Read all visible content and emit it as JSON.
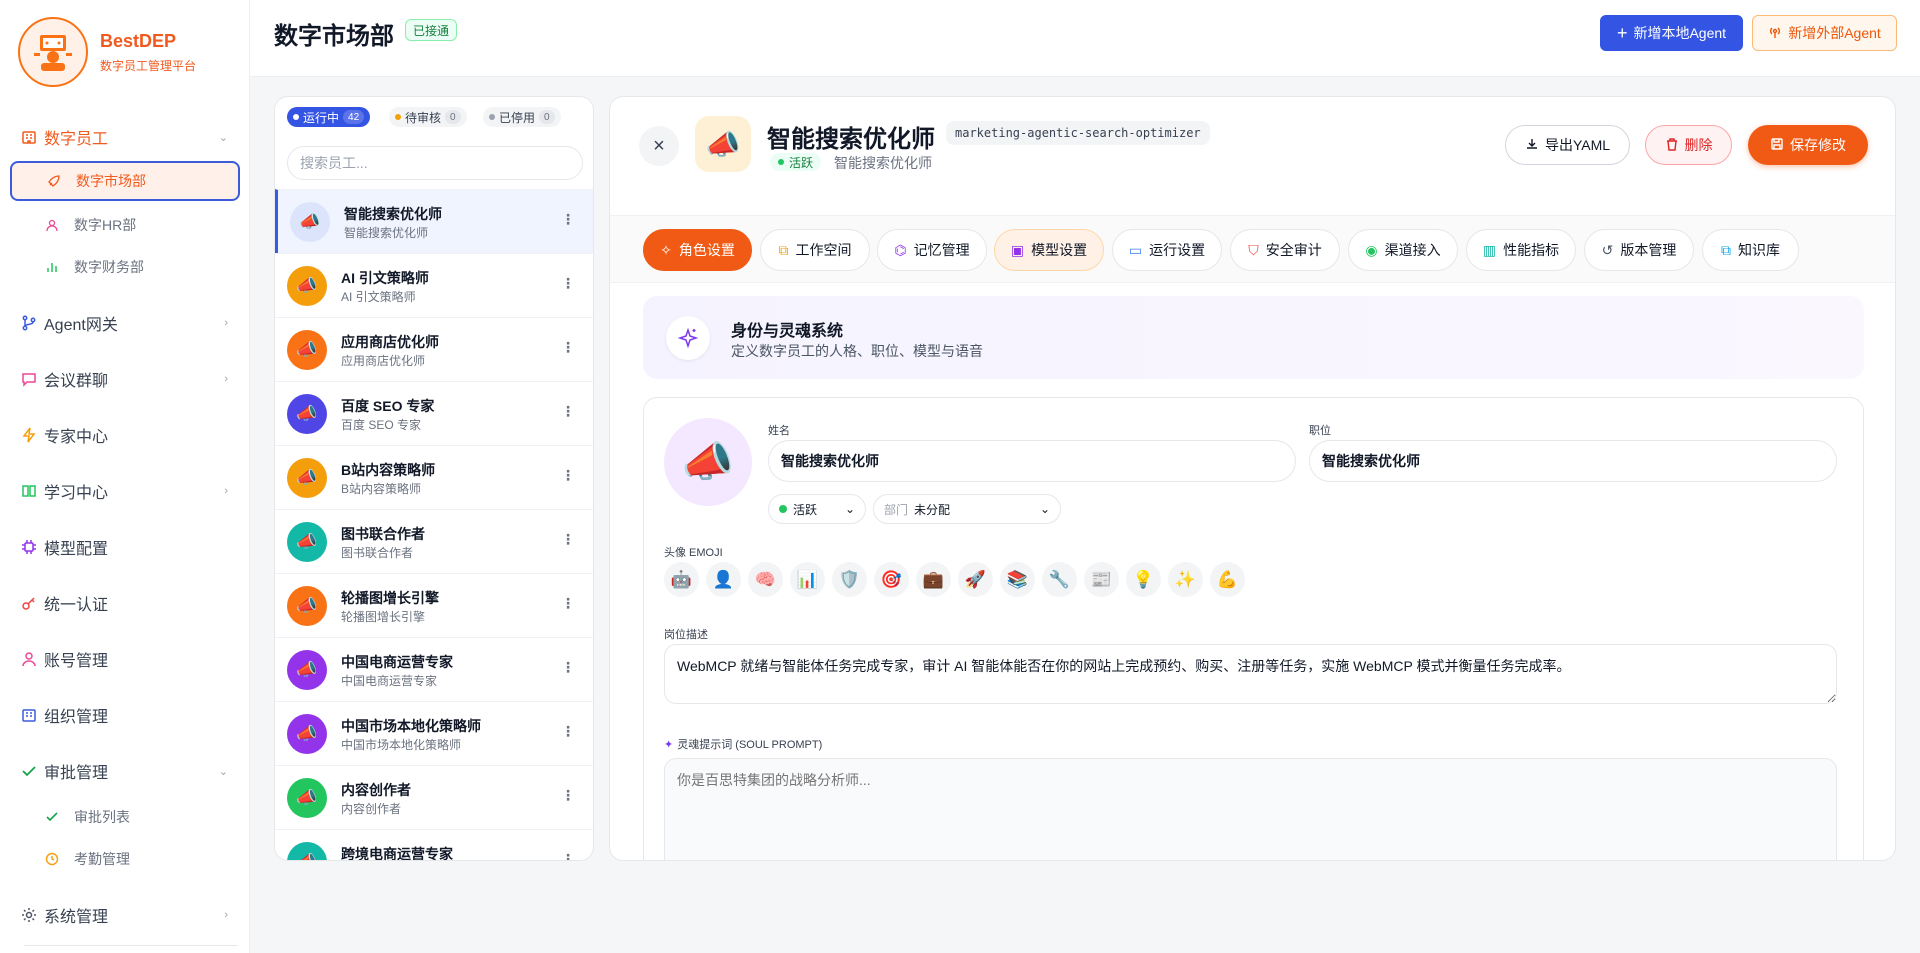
{
  "brand": {
    "name": "BestDEP",
    "subtitle": "数字员工管理平台"
  },
  "sidebar": {
    "items": [
      {
        "label": "数字员工",
        "icon": "building-icon"
      },
      {
        "label": "Agent网关",
        "icon": "branch-icon"
      },
      {
        "label": "会议群聊",
        "icon": "chat-icon"
      },
      {
        "label": "专家中心",
        "icon": "bolt-icon"
      },
      {
        "label": "学习中心",
        "icon": "book-icon"
      },
      {
        "label": "模型配置",
        "icon": "chip-icon"
      },
      {
        "label": "统一认证",
        "icon": "key-icon"
      },
      {
        "label": "账号管理",
        "icon": "user-icon"
      },
      {
        "label": "组织管理",
        "icon": "building-icon"
      },
      {
        "label": "审批管理",
        "icon": "check-icon"
      },
      {
        "label": "系统管理",
        "icon": "gear-icon"
      }
    ],
    "sub_digital": [
      "数字市场部",
      "数字HR部",
      "数字财务部"
    ],
    "sub_approval": [
      "审批列表",
      "考勤管理"
    ]
  },
  "header": {
    "title": "数字市场部",
    "badge": "已接通",
    "btn_local": "新增本地Agent",
    "btn_external": "新增外部Agent"
  },
  "list": {
    "filters": [
      {
        "label": "运行中",
        "count": "42",
        "color": "#3b5bdb"
      },
      {
        "label": "待审核",
        "count": "0",
        "color": "#f59e0b"
      },
      {
        "label": "已停用",
        "count": "0",
        "color": "#9ca3af"
      }
    ],
    "search_placeholder": "搜索员工...",
    "employees": [
      {
        "name": "智能搜索优化师",
        "role": "智能搜索优化师",
        "color": "#dbe4fb"
      },
      {
        "name": "AI 引文策略师",
        "role": "AI 引文策略师",
        "color": "#f59e0b"
      },
      {
        "name": "应用商店优化师",
        "role": "应用商店优化师",
        "color": "#f97316"
      },
      {
        "name": "百度 SEO 专家",
        "role": "百度 SEO 专家",
        "color": "#4f46e5"
      },
      {
        "name": "B站内容策略师",
        "role": "B站内容策略师",
        "color": "#f59e0b"
      },
      {
        "name": "图书联合作者",
        "role": "图书联合作者",
        "color": "#14b8a6"
      },
      {
        "name": "轮播图增长引擎",
        "role": "轮播图增长引擎",
        "color": "#f97316"
      },
      {
        "name": "中国电商运营专家",
        "role": "中国电商运营专家",
        "color": "#9333ea"
      },
      {
        "name": "中国市场本地化策略师",
        "role": "中国市场本地化策略师",
        "color": "#9333ea"
      },
      {
        "name": "内容创作者",
        "role": "内容创作者",
        "color": "#22c55e"
      },
      {
        "name": "跨境电商运营专家",
        "role": "",
        "color": "#14b8a6"
      }
    ]
  },
  "detail": {
    "name": "智能搜索优化师",
    "slug": "marketing-agentic-search-optimizer",
    "status": "活跃",
    "role": "智能搜索优化师",
    "btn_export": "导出YAML",
    "btn_delete": "删除",
    "btn_save": "保存修改",
    "tabs": [
      "角色设置",
      "工作空间",
      "记忆管理",
      "模型设置",
      "运行设置",
      "安全审计",
      "渠道接入",
      "性能指标",
      "版本管理",
      "知识库"
    ],
    "section_title": "身份与灵魂系统",
    "section_subtitle": "定义数字员工的人格、职位、模型与语音",
    "form": {
      "name_label": "姓名",
      "name_value": "智能搜索优化师",
      "position_label": "职位",
      "position_value": "智能搜索优化师",
      "status_value": "活跃",
      "dept_label": "部门",
      "dept_value": "未分配",
      "emoji_label": "头像 EMOJI",
      "emojis": [
        "🤖",
        "👤",
        "🧠",
        "📊",
        "🛡️",
        "🎯",
        "💼",
        "🚀",
        "📚",
        "🔧",
        "📰",
        "💡",
        "✨",
        "💪"
      ],
      "desc_label": "岗位描述",
      "desc_value": "WebMCP 就绪与智能体任务完成专家，审计 AI 智能体能否在你的网站上完成预约、购买、注册等任务，实施 WebMCP 模式并衡量任务完成率。",
      "soul_label": "灵魂提示词 (SOUL PROMPT)",
      "soul_placeholder": "你是百思特集团的战略分析师..."
    }
  },
  "colors": {
    "accent": "#f05a14",
    "primary": "#3454e4"
  }
}
